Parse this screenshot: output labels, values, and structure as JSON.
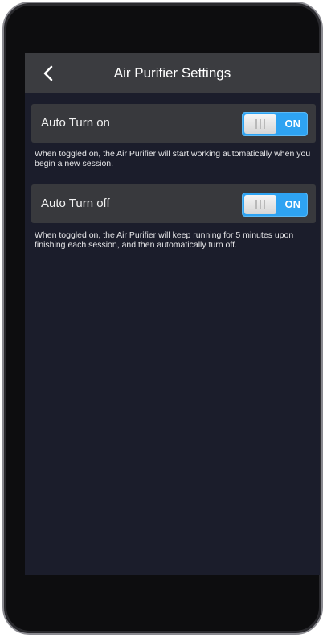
{
  "header": {
    "title": "Air Purifier Settings",
    "back_icon": "chevron-left-icon"
  },
  "settings": [
    {
      "label": "Auto Turn on",
      "toggle_state": "ON",
      "description": "When toggled on, the Air Purifier will start working automatically when you begin a new session."
    },
    {
      "label": "Auto Turn off",
      "toggle_state": "ON",
      "description": "When toggled on, the Air Purifier will keep running for 5 minutes upon finishing each session, and then automatically turn off."
    }
  ],
  "colors": {
    "toggle_on": "#2ea3f2",
    "screen_bg": "#1b1d2b",
    "row_bg": "#38393d",
    "header_bg": "#3b3c40"
  }
}
